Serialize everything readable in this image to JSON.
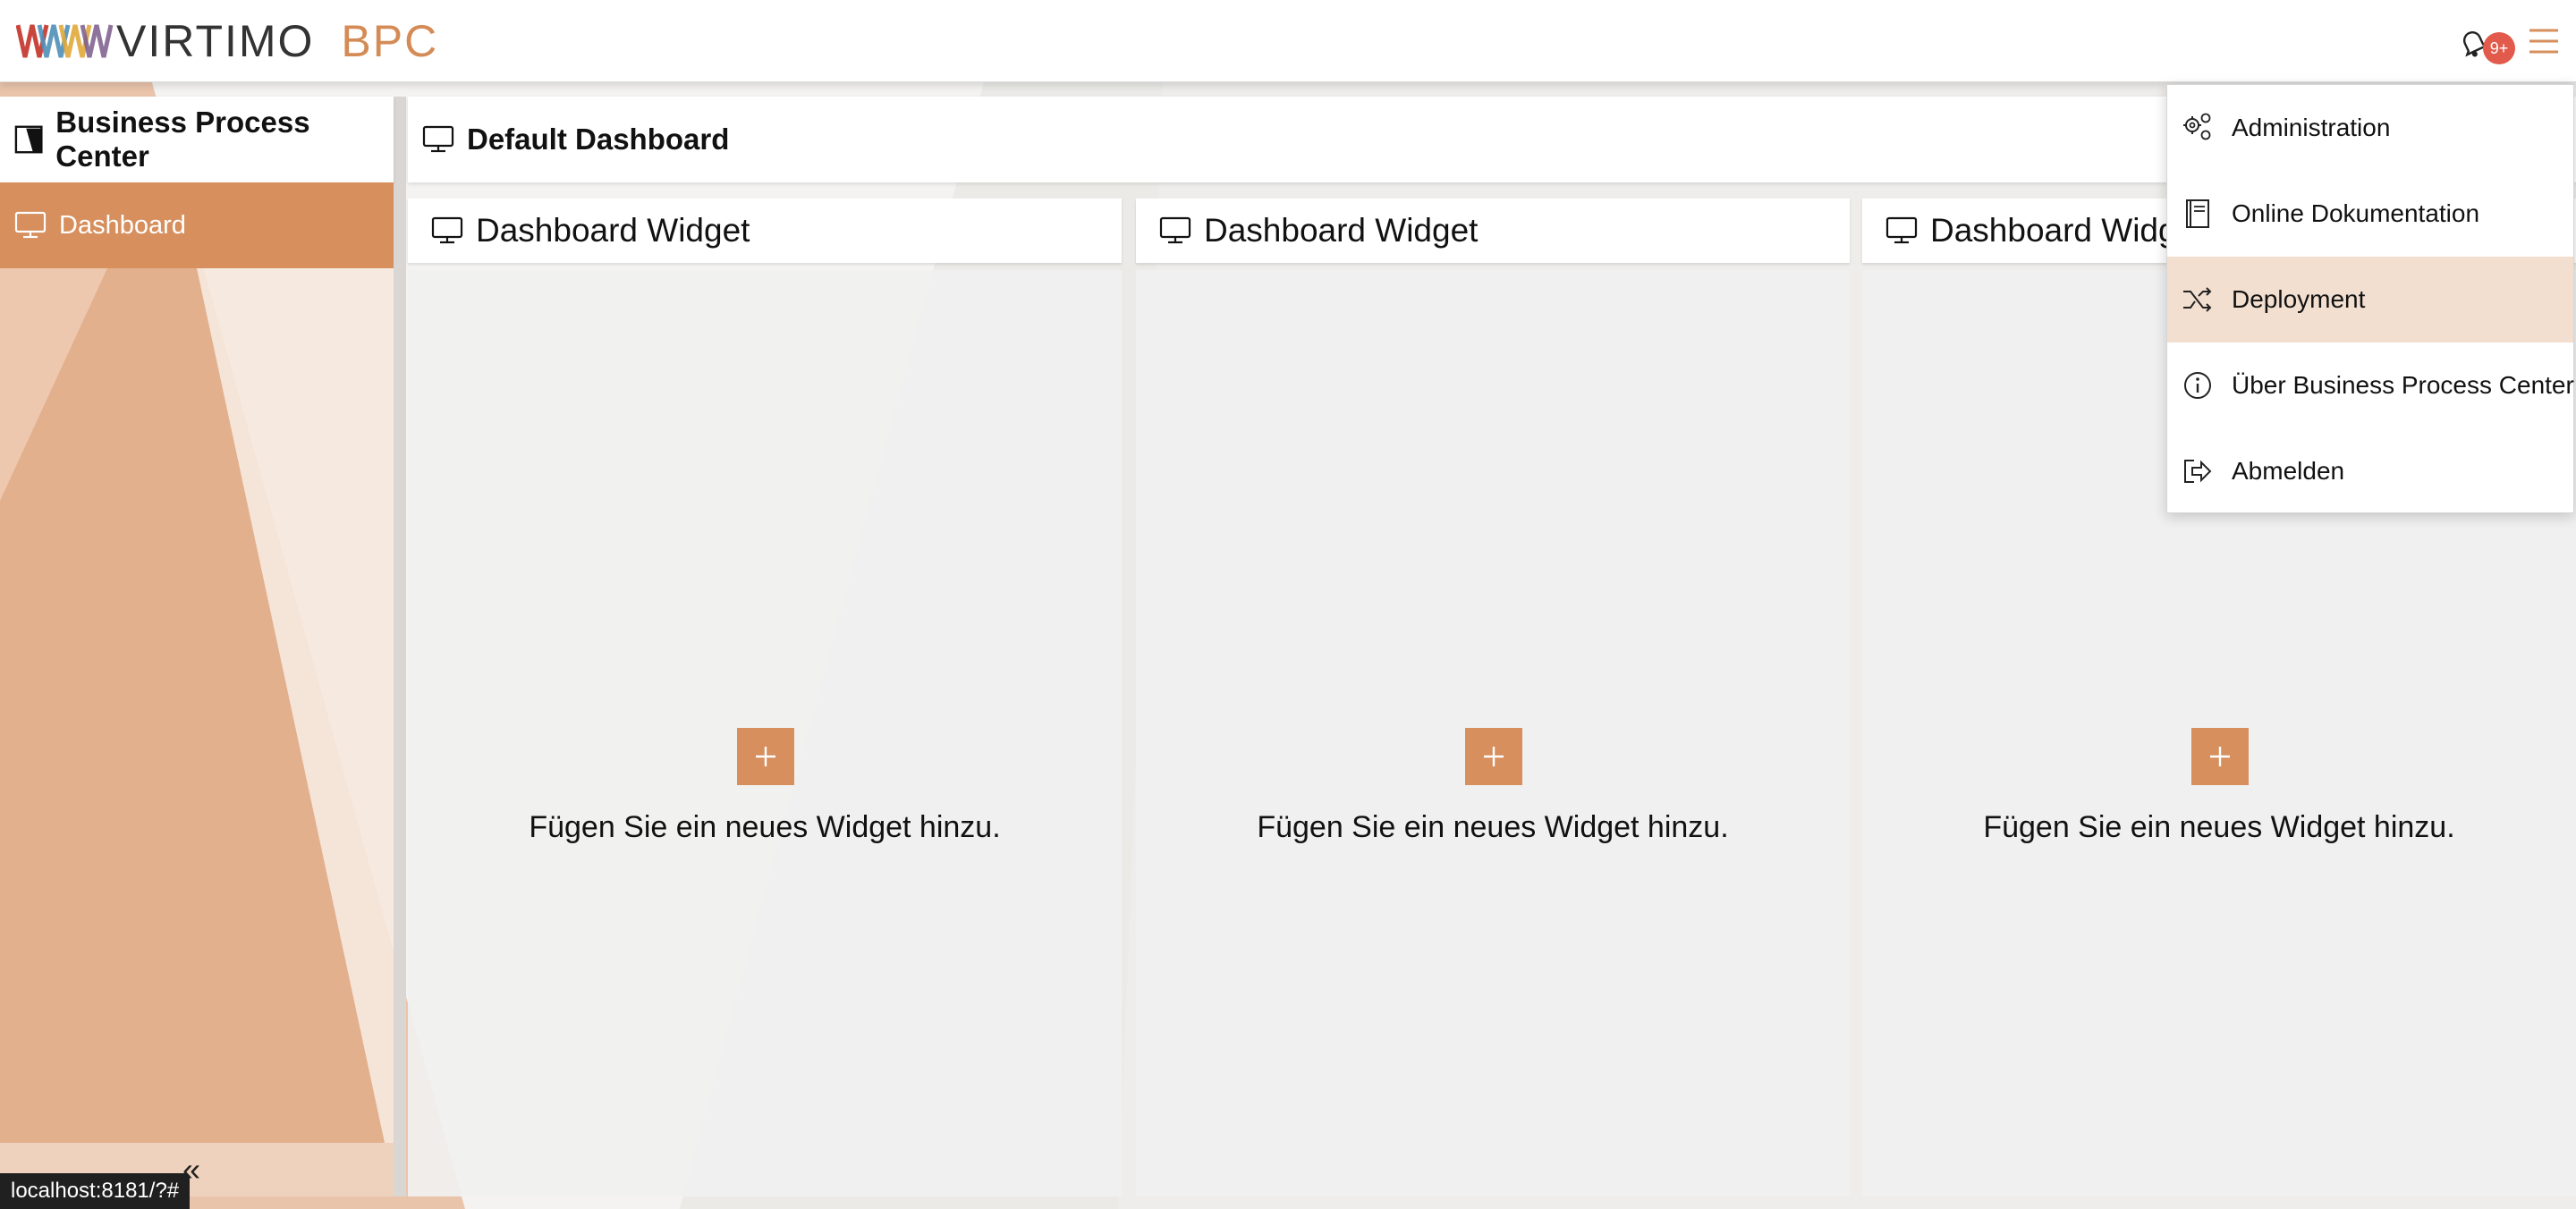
{
  "header": {
    "brand": "VIRTIMO",
    "product": "BPC",
    "notification_count": "9+",
    "accent_color": "#d68f5d"
  },
  "sidebar": {
    "title": "Business Process Center",
    "items": [
      {
        "label": "Dashboard",
        "icon": "monitor-icon",
        "active": true
      }
    ],
    "collapse_label": "«"
  },
  "dashboard": {
    "title": "Default Dashboard",
    "widgets": [
      {
        "title": "Dashboard Widget",
        "add_label": "+",
        "hint": "Fügen Sie ein neues Widget hinzu."
      },
      {
        "title": "Dashboard Widget",
        "add_label": "+",
        "hint": "Fügen Sie ein neues Widget hinzu."
      },
      {
        "title": "Dashboard Widget",
        "add_label": "+",
        "hint": "Fügen Sie ein neues Widget hinzu."
      }
    ]
  },
  "menu": {
    "items": [
      {
        "label": "Administration",
        "icon": "gears-icon"
      },
      {
        "label": "Online Dokumentation",
        "icon": "book-icon"
      },
      {
        "label": "Deployment",
        "icon": "shuffle-icon",
        "active": true
      },
      {
        "label": "Über Business Process Center",
        "icon": "info-icon"
      },
      {
        "label": "Abmelden",
        "icon": "logout-icon"
      }
    ]
  },
  "statusbar": {
    "url": "localhost:8181/?#"
  }
}
